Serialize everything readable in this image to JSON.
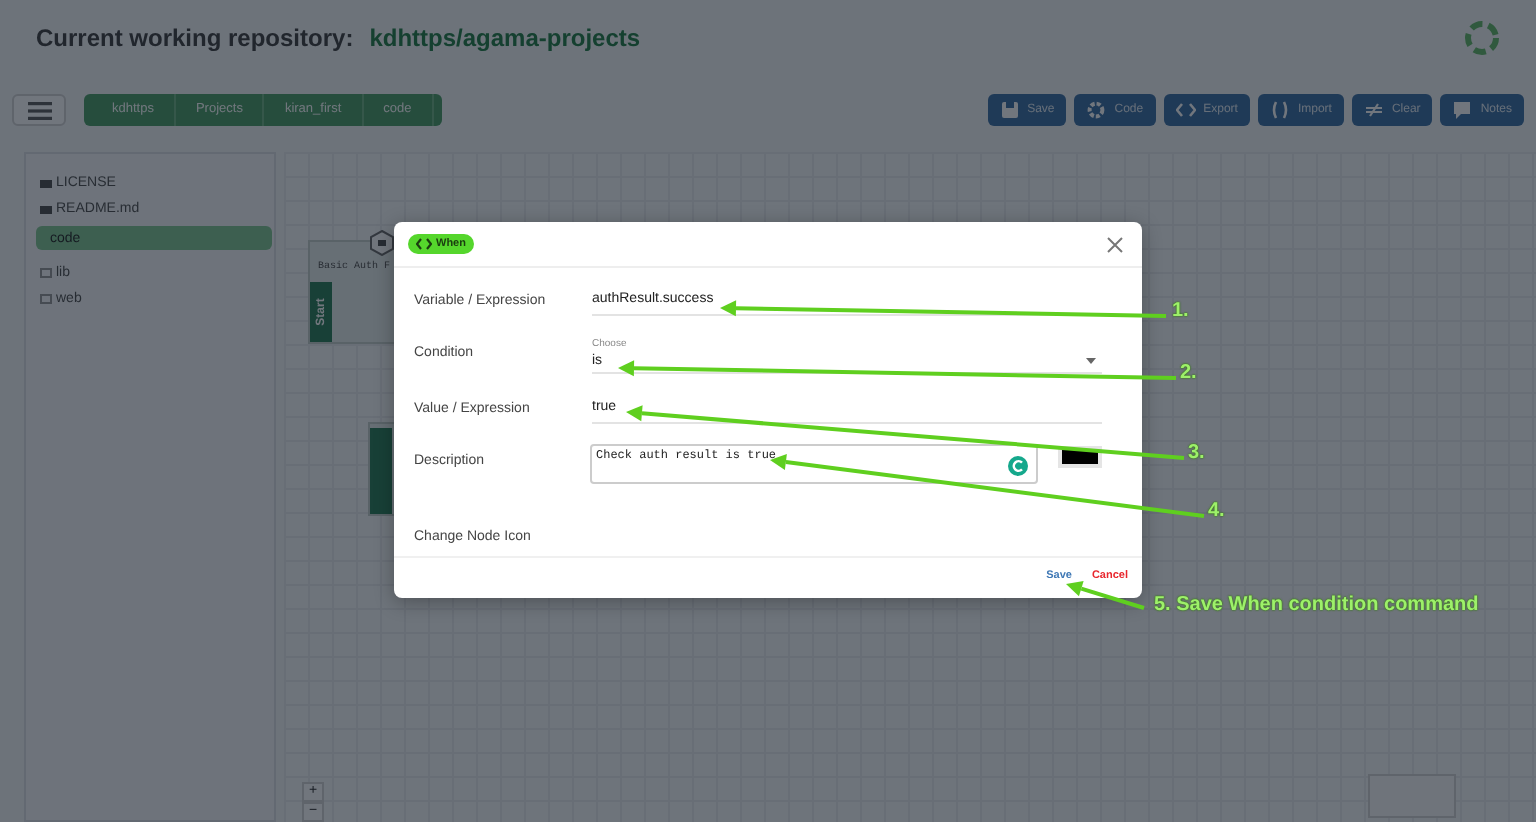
{
  "header": {
    "label": "Current working repository:",
    "repository": "kdhttps/agama-projects"
  },
  "toolbar": {
    "breadcrumbs": [
      "kdhttps",
      "Projects",
      "kiran_first",
      "code"
    ],
    "actions": [
      {
        "label": "Save"
      },
      {
        "label": "Code"
      },
      {
        "label": "Export"
      },
      {
        "label": "Import"
      },
      {
        "label": "Clear"
      },
      {
        "label": "Notes"
      }
    ]
  },
  "sidebar": {
    "items": [
      {
        "name": "LICENSE",
        "kind": "file",
        "selected": false
      },
      {
        "name": "README.md",
        "kind": "file",
        "selected": false
      },
      {
        "name": "code",
        "kind": "folder",
        "selected": true
      },
      {
        "name": "lib",
        "kind": "folder",
        "selected": false
      },
      {
        "name": "web",
        "kind": "folder",
        "selected": false
      }
    ]
  },
  "canvas": {
    "nodes": [
      {
        "title": "Basic Auth F",
        "side_label": "Start"
      }
    ],
    "zoom_controls": [
      "+",
      "−"
    ]
  },
  "modal": {
    "badge": "When",
    "fields": [
      {
        "kind": "text",
        "label": "Variable / Expression",
        "value": "authResult.success"
      },
      {
        "kind": "select",
        "label": "Condition",
        "caption": "Choose",
        "value": "is"
      },
      {
        "kind": "text",
        "label": "Value / Expression",
        "value": "true"
      },
      {
        "kind": "textarea",
        "label": "Description",
        "value": "Check auth result is true"
      },
      {
        "kind": "icon",
        "label": "Change Node Icon"
      }
    ],
    "buttons": [
      {
        "label": "Save",
        "kind": "primary"
      },
      {
        "label": "Cancel",
        "kind": "danger"
      }
    ]
  },
  "annotations": [
    {
      "label": "1."
    },
    {
      "label": "2."
    },
    {
      "label": "3."
    },
    {
      "label": "4."
    },
    {
      "label": "5. Save When condition command"
    }
  ]
}
